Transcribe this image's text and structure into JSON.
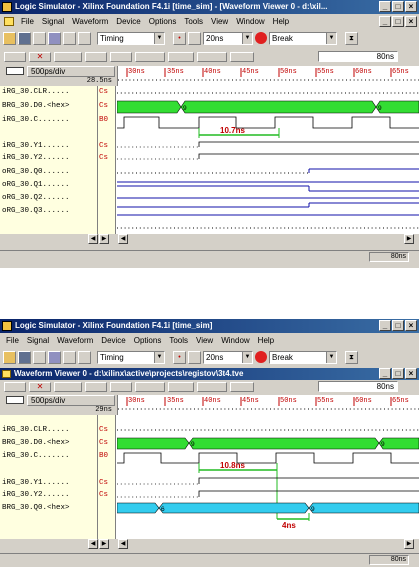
{
  "top": {
    "title": "Logic Simulator - Xilinx Foundation F4.1i [time_sim] - [Waveform Viewer 0 - d:\\xil...",
    "menu": [
      "File",
      "Signal",
      "Waveform",
      "Device",
      "Options",
      "Tools",
      "View",
      "Window",
      "Help"
    ],
    "toolbar": {
      "mode": "Timing",
      "step": "20ns",
      "break_label": "Break"
    },
    "zoom_field": "80ns",
    "scale": "500ps/div",
    "cursor_time": "28.5ns",
    "ticks": [
      "30ns",
      "35ns",
      "40ns",
      "45ns",
      "50ns",
      "55ns",
      "60ns",
      "65ns"
    ],
    "signals": [
      {
        "dir": "i",
        "name": "RG_30.CLR.....",
        "type": "Cs"
      },
      {
        "dir": "B",
        "name": "RG_30.D0.<hex>",
        "type": "Cs"
      },
      {
        "dir": "i",
        "name": "RG_30.C.......",
        "type": "B0"
      },
      {
        "dir": "",
        "name": "",
        "type": ""
      },
      {
        "dir": "i",
        "name": "RG_30.Y1......",
        "type": "Cs"
      },
      {
        "dir": "i",
        "name": "RG_30.Y2......",
        "type": "Cs"
      },
      {
        "dir": "o",
        "name": "RG_30.Q0......",
        "type": ""
      },
      {
        "dir": "o",
        "name": "RG_30.Q1......",
        "type": ""
      },
      {
        "dir": "o",
        "name": "RG_30.Q2......",
        "type": ""
      },
      {
        "dir": "o",
        "name": "RG_30.Q3......",
        "type": ""
      }
    ],
    "bus_labels": [
      "9",
      "6"
    ],
    "measure": "10.7ns",
    "status": "80ns"
  },
  "bottom": {
    "title": "Logic Simulator - Xilinx Foundation F4.1i [time_sim]",
    "menu": [
      "File",
      "Signal",
      "Waveform",
      "Device",
      "Options",
      "Tools",
      "View",
      "Window",
      "Help"
    ],
    "toolbar": {
      "mode": "Timing",
      "step": "20ns",
      "break_label": "Break"
    },
    "child_title": "Waveform Viewer 0 - d:\\xilinx\\active\\projects\\registov\\3t4.tve",
    "zoom_field": "80ns",
    "scale": "500ps/div",
    "cursor_time": "29ns",
    "ticks": [
      "30ns",
      "35ns",
      "40ns",
      "45ns",
      "50ns",
      "55ns",
      "60ns",
      "65ns"
    ],
    "signals": [
      {
        "dir": "i",
        "name": "RG_30.CLR.....",
        "type": "Cs"
      },
      {
        "dir": "B",
        "name": "RG_30.D0.<hex>",
        "type": "Cs"
      },
      {
        "dir": "i",
        "name": "RG_30.C.......",
        "type": "B0"
      },
      {
        "dir": "",
        "name": "",
        "type": ""
      },
      {
        "dir": "i",
        "name": "RG_30.Y1......",
        "type": "Cs"
      },
      {
        "dir": "i",
        "name": "RG_30.Y2......",
        "type": "Cs"
      },
      {
        "dir": "B",
        "name": "RG_30.Q0.<hex>",
        "type": ""
      }
    ],
    "bus_labels": [
      "9",
      "6"
    ],
    "q_labels": [
      "6",
      "9"
    ],
    "measure": "10.8ns",
    "measure2": "4ns",
    "status": "80ns"
  }
}
